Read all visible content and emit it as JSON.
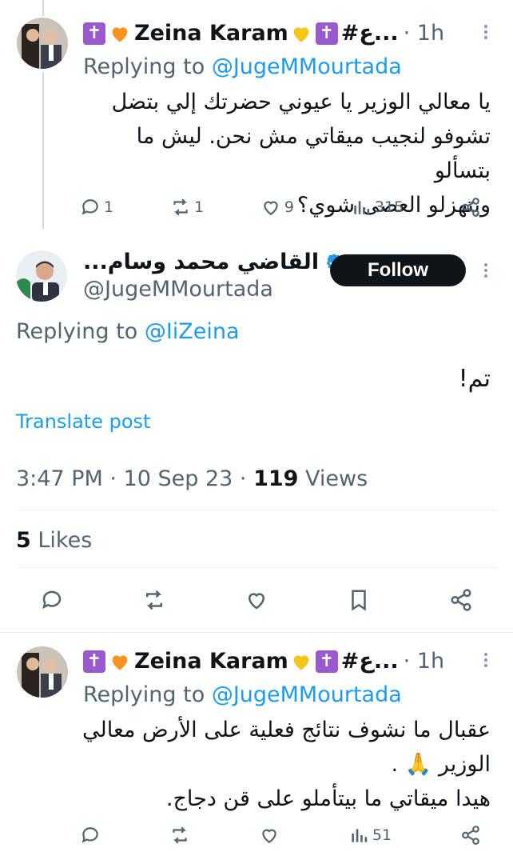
{
  "reply_1": {
    "display_name": "Zeina Karam",
    "name_suffix": "#ع...",
    "time": "· 1h",
    "replying_prefix": "Replying to ",
    "replying_handle": "@JugeMMourtada",
    "text_lines": [
      "يا معالي الوزير يا عيوني حضرتك إلي بتضل",
      "تشوفو لنجيب ميقاتي مش نحن. ليش ما بتسألو",
      "وبتهزلو العصى شوي؟"
    ],
    "stats": {
      "replies": "1",
      "reposts": "1",
      "likes": "9",
      "views": "315"
    }
  },
  "main_post": {
    "display_name": "القاضي محمد وسام...",
    "handle": "@JugeMMourtada",
    "follow_label": "Follow",
    "replying_prefix": "Replying to ",
    "replying_handle": "@IiZeina",
    "text": "تم!",
    "translate_label": "Translate post",
    "timestamp": "3:47 PM · 10 Sep 23 · ",
    "views_count": "119",
    "views_label": " Views",
    "likes_count": "5",
    "likes_label": " Likes"
  },
  "reply_2": {
    "display_name": "Zeina Karam",
    "name_suffix": "#ع...",
    "time": "· 1h",
    "replying_prefix": "Replying to ",
    "replying_handle": "@JugeMMourtada",
    "text_lines": [
      "عقبال ما نشوف نتائج فعلية على الأرض معالي",
      "الوزير 🙏 .",
      "هيدا ميقاتي ما بيتأملو على قن دجاج."
    ],
    "stats": {
      "views": "51"
    }
  },
  "colors": {
    "accent": "#1d9bf0",
    "muted": "#536471",
    "cross_emoji": "#9b59d0",
    "orange_heart": "#f7931e",
    "yellow_heart": "#f5c518"
  },
  "icons": [
    "cross-emoji",
    "orange-heart-emoji",
    "yellow-heart-emoji",
    "verified-badge-icon",
    "more-dots-icon",
    "reply-icon",
    "repost-icon",
    "like-icon",
    "views-icon",
    "bookmark-icon",
    "share-icon"
  ]
}
